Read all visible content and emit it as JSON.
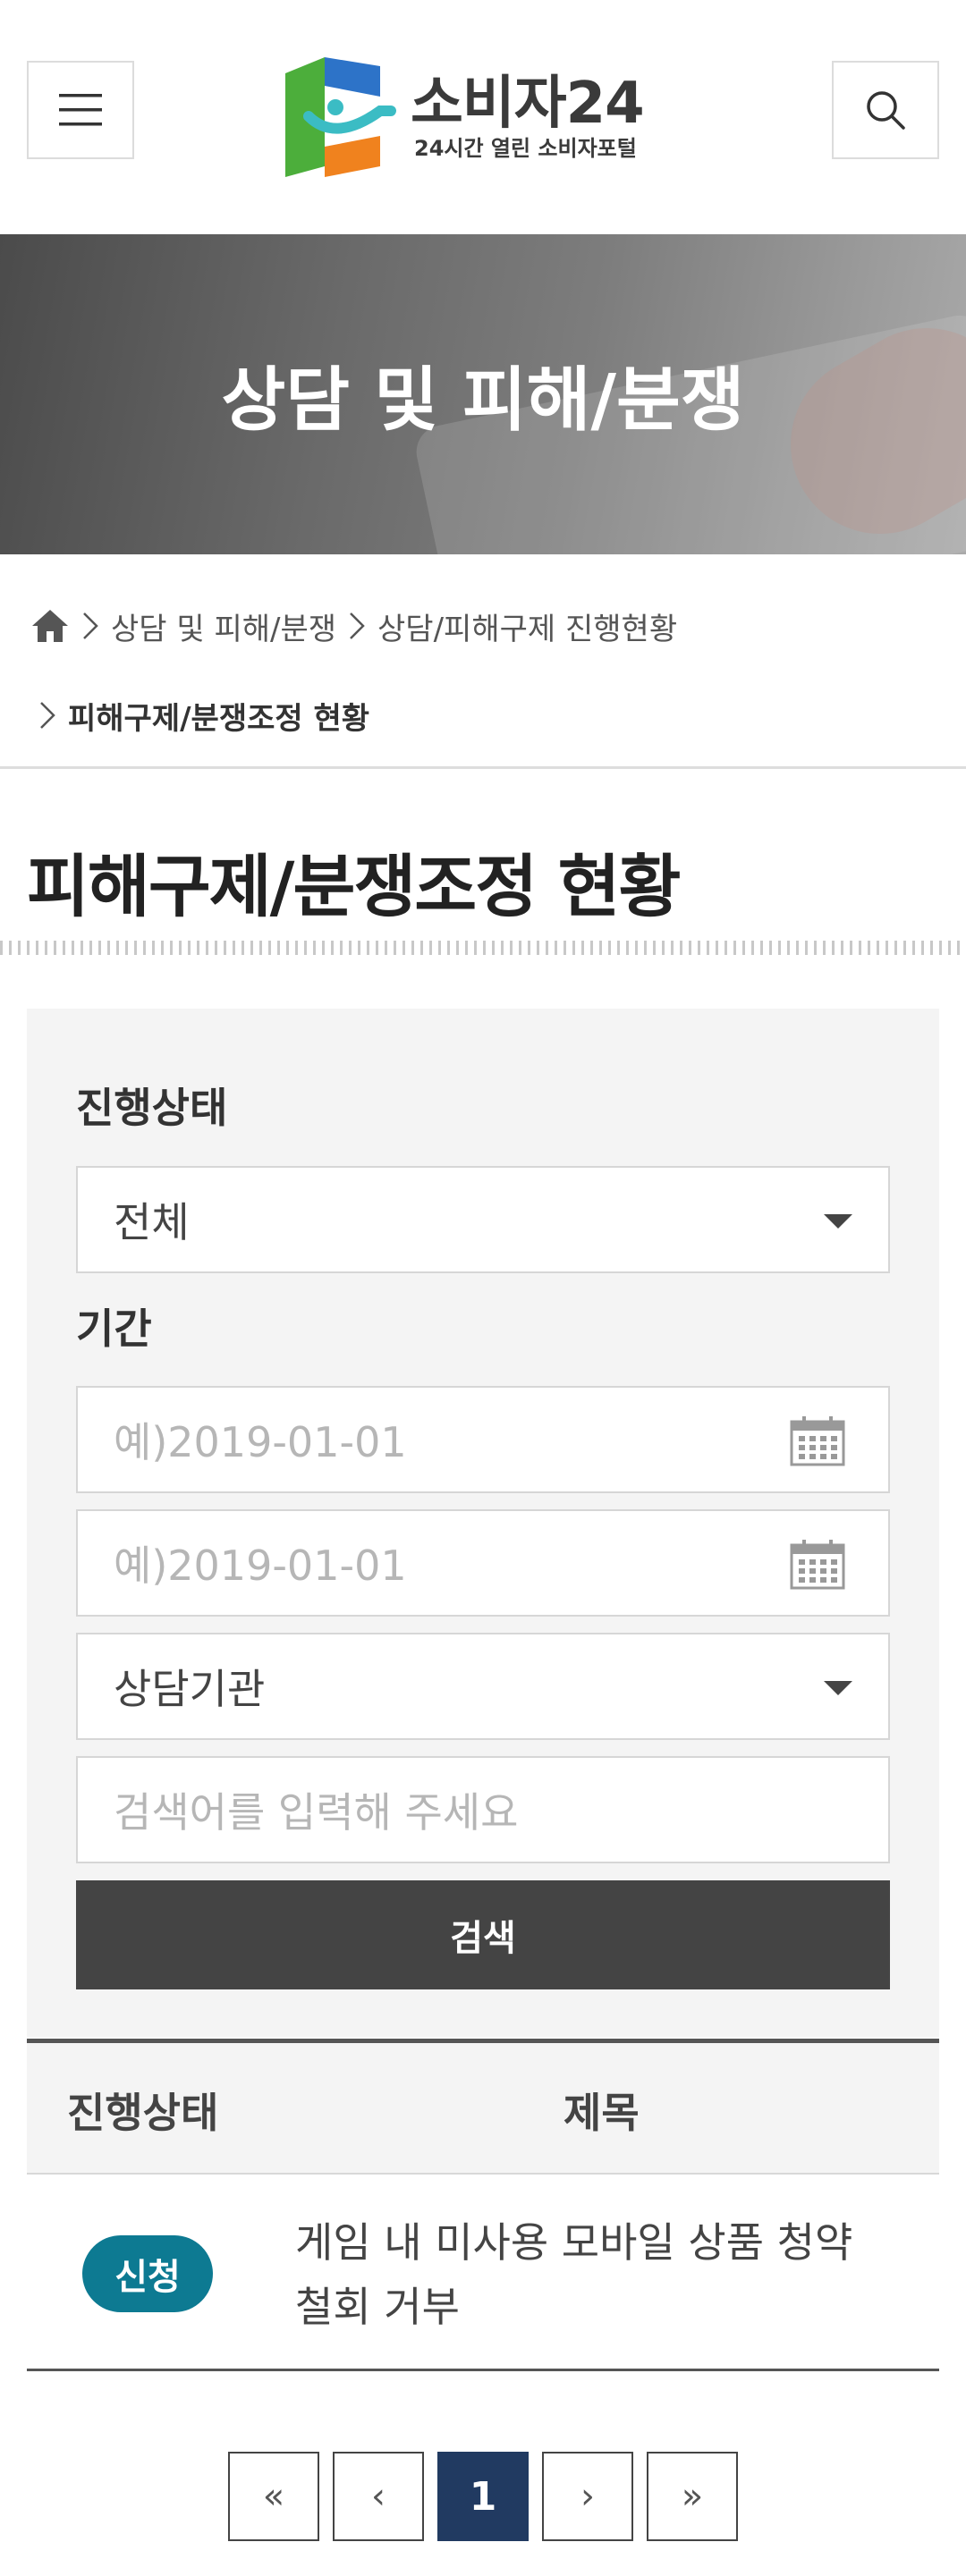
{
  "header": {
    "logo_main": "소비자24",
    "logo_sub": "24시간 열린 소비자포털",
    "menu_icon": "hamburger-icon",
    "search_icon": "search-icon"
  },
  "banner": {
    "title": "상담 및 피해/분쟁"
  },
  "breadcrumb": {
    "items": [
      "상담 및 피해/분쟁",
      "상담/피해구제 진행현황",
      "피해구제/분쟁조정 현황"
    ]
  },
  "page": {
    "title": "피해구제/분쟁조정 현황"
  },
  "search": {
    "status_label": "진행상태",
    "status_value": "전체",
    "period_label": "기간",
    "start_placeholder": "예)2019-01-01",
    "end_placeholder": "예)2019-01-01",
    "agency_value": "상담기관",
    "keyword_placeholder": "검색어를 입력해 주세요",
    "submit_label": "검색"
  },
  "table": {
    "headers": {
      "status": "진행상태",
      "title": "제목"
    },
    "rows": [
      {
        "status": "신청",
        "title": "게임 내 미사용 모바일 상품 청약 철회 거부"
      }
    ]
  },
  "pagination": {
    "first": "«",
    "prev": "‹",
    "current": "1",
    "next": "›",
    "last": "»"
  },
  "colors": {
    "badge": "#0d7a92",
    "active_page": "#213a61",
    "submit_button": "#444444",
    "logo_green": "#4cae3b",
    "logo_orange": "#f0821e",
    "logo_blue": "#2d73c8",
    "logo_teal": "#3bbcc4"
  }
}
